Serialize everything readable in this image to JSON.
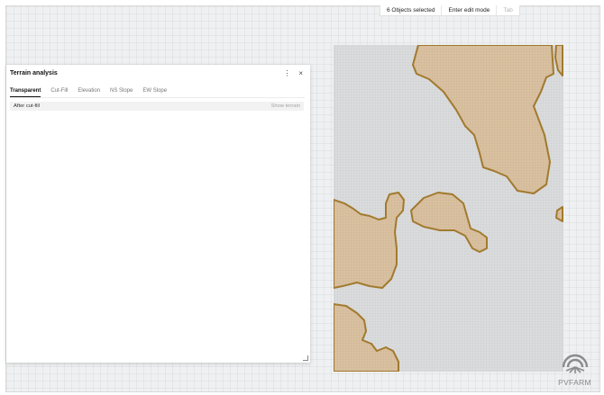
{
  "topbar": {
    "selection_label": "6 Objects selected",
    "edit_mode_label": "Enter edit mode",
    "tab_label": "Tab"
  },
  "panel": {
    "title": "Terrain analysis",
    "more_icon": "more-vertical-icon",
    "close_icon": "close-icon",
    "tabs": [
      {
        "label": "Transparent",
        "active": true
      },
      {
        "label": "Cut-Fill",
        "active": false
      },
      {
        "label": "Elevation",
        "active": false
      },
      {
        "label": "NS Slope",
        "active": false
      },
      {
        "label": "EW Slope",
        "active": false
      }
    ],
    "rows": [
      {
        "label": "After cut-fill",
        "action": "Show terrain"
      }
    ]
  },
  "logo": {
    "text": "PVFARM"
  },
  "colors": {
    "canvas_bg": "#eff0f1",
    "terrain_area": "#d9dadb",
    "terrain_fill": "#d7bf9f",
    "terrain_stroke": "#a27a2e",
    "logo": "#8a8a8a"
  }
}
